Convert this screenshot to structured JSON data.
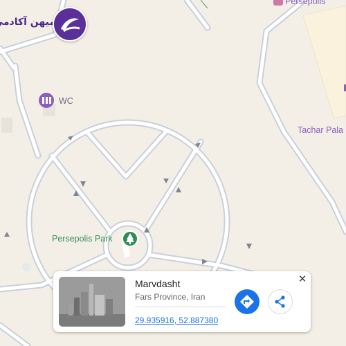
{
  "map": {
    "labels": {
      "wc": "WC",
      "persepolis_top": "Persepolis",
      "tachar_palace": "Tachar Pala",
      "persepolis_park": "Persepolis Park"
    }
  },
  "logo": {
    "text": "میهن آکادمی"
  },
  "place_card": {
    "title": "Marvdasht",
    "subtitle": "Fars Province, Iran",
    "coordinates": "29.935916, 52.887380"
  },
  "colors": {
    "background": "#f4efe6",
    "road_fill": "#ffffff",
    "road_edge": "#c8d0dc",
    "poi_purple": "#8b5fbf",
    "park_green": "#2e8b57",
    "landmark_fill": "#fbf2de",
    "accent_blue": "#1a73e8"
  }
}
